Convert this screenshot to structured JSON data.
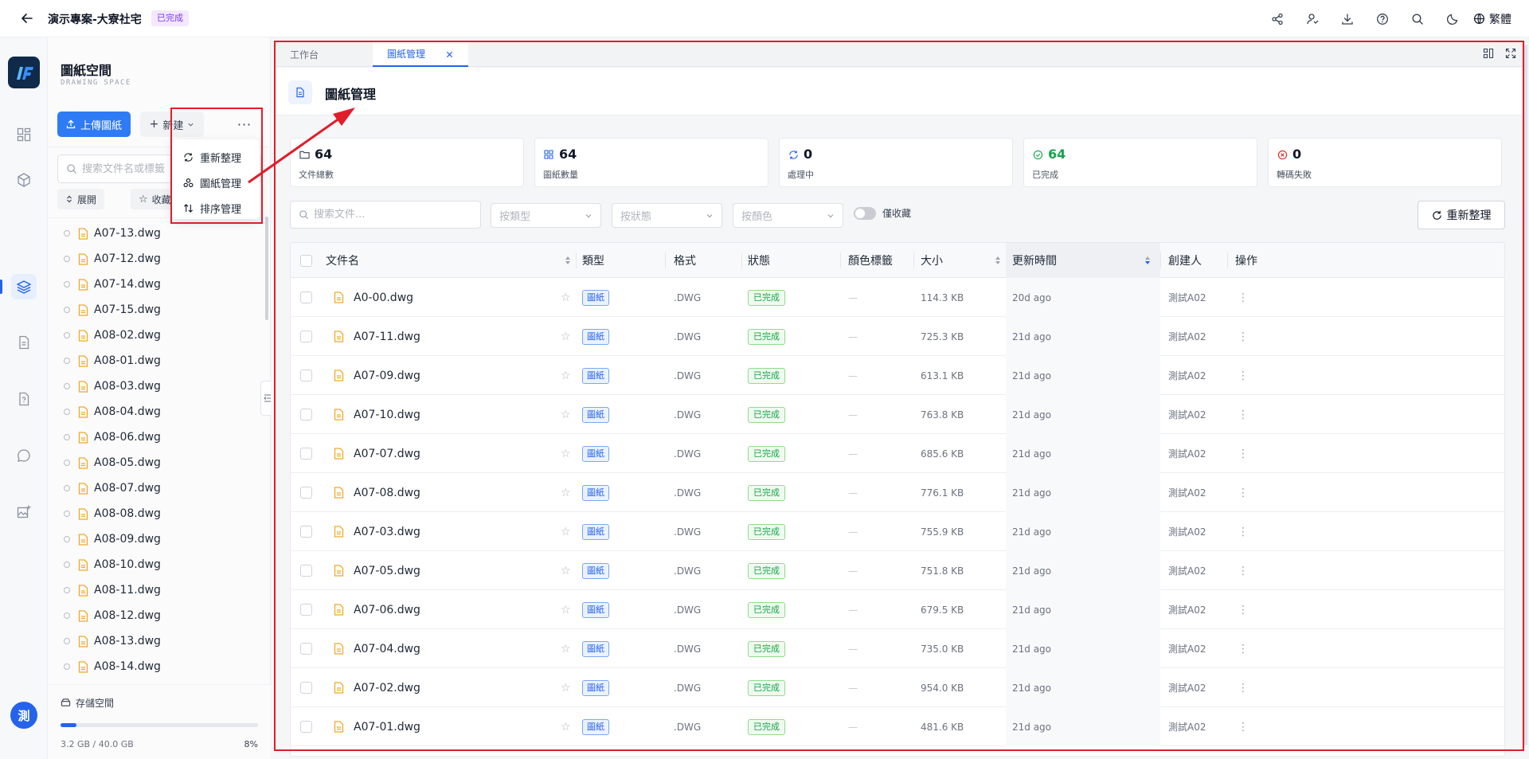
{
  "header": {
    "project_title": "演示專案-大寮社宅",
    "status_badge": "已完成",
    "language": "繁體"
  },
  "rail": {
    "avatar_letter": "測"
  },
  "sidebar": {
    "title": "圖紙空間",
    "subtitle": "DRAWING SPACE",
    "upload_label": "上傳圖紙",
    "new_label": "新建",
    "more_label": "···",
    "search_placeholder": "搜索文件名或標籤",
    "chip_expand": "展開",
    "chip_favorite": "收藏",
    "files": [
      "A07-13.dwg",
      "A07-12.dwg",
      "A07-14.dwg",
      "A07-15.dwg",
      "A08-02.dwg",
      "A08-01.dwg",
      "A08-03.dwg",
      "A08-04.dwg",
      "A08-06.dwg",
      "A08-05.dwg",
      "A08-07.dwg",
      "A08-08.dwg",
      "A08-09.dwg",
      "A08-10.dwg",
      "A08-11.dwg",
      "A08-12.dwg",
      "A08-13.dwg",
      "A08-14.dwg"
    ],
    "storage_label": "存儲空間",
    "storage_used": "3.2 GB / 40.0 GB",
    "storage_percent": "8%",
    "storage_fraction": 0.08
  },
  "dropdown": {
    "items": [
      "重新整理",
      "圖紙管理",
      "排序管理"
    ]
  },
  "tabs": {
    "workbench": "工作台",
    "active": "圖紙管理"
  },
  "page": {
    "title": "圖紙管理"
  },
  "stats": [
    {
      "value": "64",
      "label": "文件總數",
      "color": "#111827"
    },
    {
      "value": "64",
      "label": "圖紙數量",
      "color": "#111827"
    },
    {
      "value": "0",
      "label": "處理中",
      "color": "#111827"
    },
    {
      "value": "64",
      "label": "已完成",
      "color": "#16a34a"
    },
    {
      "value": "0",
      "label": "轉碼失敗",
      "color": "#111827"
    }
  ],
  "filters": {
    "search_placeholder": "搜索文件...",
    "type_placeholder": "按類型",
    "status_placeholder": "按狀態",
    "color_placeholder": "按顏色",
    "favorites_only": "僅收藏",
    "reorganize_label": "重新整理"
  },
  "table": {
    "columns": [
      "文件名",
      "類型",
      "格式",
      "狀態",
      "顏色標籤",
      "大小",
      "更新時間",
      "創建人",
      "操作"
    ],
    "rows": [
      {
        "name": "A0-00.dwg",
        "type": "圖紙",
        "format": ".DWG",
        "status": "已完成",
        "color_tag": "—",
        "size": "114.3 KB",
        "updated": "20d ago",
        "creator": "測試A02",
        "action": "⋮"
      },
      {
        "name": "A07-11.dwg",
        "type": "圖紙",
        "format": ".DWG",
        "status": "已完成",
        "color_tag": "—",
        "size": "725.3 KB",
        "updated": "21d ago",
        "creator": "測試A02",
        "action": "⋮"
      },
      {
        "name": "A07-09.dwg",
        "type": "圖紙",
        "format": ".DWG",
        "status": "已完成",
        "color_tag": "—",
        "size": "613.1 KB",
        "updated": "21d ago",
        "creator": "測試A02",
        "action": "⋮"
      },
      {
        "name": "A07-10.dwg",
        "type": "圖紙",
        "format": ".DWG",
        "status": "已完成",
        "color_tag": "—",
        "size": "763.8 KB",
        "updated": "21d ago",
        "creator": "測試A02",
        "action": "⋮"
      },
      {
        "name": "A07-07.dwg",
        "type": "圖紙",
        "format": ".DWG",
        "status": "已完成",
        "color_tag": "—",
        "size": "685.6 KB",
        "updated": "21d ago",
        "creator": "測試A02",
        "action": "⋮"
      },
      {
        "name": "A07-08.dwg",
        "type": "圖紙",
        "format": ".DWG",
        "status": "已完成",
        "color_tag": "—",
        "size": "776.1 KB",
        "updated": "21d ago",
        "creator": "測試A02",
        "action": "⋮"
      },
      {
        "name": "A07-03.dwg",
        "type": "圖紙",
        "format": ".DWG",
        "status": "已完成",
        "color_tag": "—",
        "size": "755.9 KB",
        "updated": "21d ago",
        "creator": "測試A02",
        "action": "⋮"
      },
      {
        "name": "A07-05.dwg",
        "type": "圖紙",
        "format": ".DWG",
        "status": "已完成",
        "color_tag": "—",
        "size": "751.8 KB",
        "updated": "21d ago",
        "creator": "測試A02",
        "action": "⋮"
      },
      {
        "name": "A07-06.dwg",
        "type": "圖紙",
        "format": ".DWG",
        "status": "已完成",
        "color_tag": "—",
        "size": "679.5 KB",
        "updated": "21d ago",
        "creator": "測試A02",
        "action": "⋮"
      },
      {
        "name": "A07-04.dwg",
        "type": "圖紙",
        "format": ".DWG",
        "status": "已完成",
        "color_tag": "—",
        "size": "735.0 KB",
        "updated": "21d ago",
        "creator": "測試A02",
        "action": "⋮"
      },
      {
        "name": "A07-02.dwg",
        "type": "圖紙",
        "format": ".DWG",
        "status": "已完成",
        "color_tag": "—",
        "size": "954.0 KB",
        "updated": "21d ago",
        "creator": "測試A02",
        "action": "⋮"
      },
      {
        "name": "A07-01.dwg",
        "type": "圖紙",
        "format": ".DWG",
        "status": "已完成",
        "color_tag": "—",
        "size": "481.6 KB",
        "updated": "21d ago",
        "creator": "測試A02",
        "action": "⋮"
      }
    ]
  },
  "colors": {
    "accent": "#2563eb",
    "annotation_red": "#e11d2a",
    "file_icon": "#f0a92a",
    "success": "#16a34a"
  }
}
